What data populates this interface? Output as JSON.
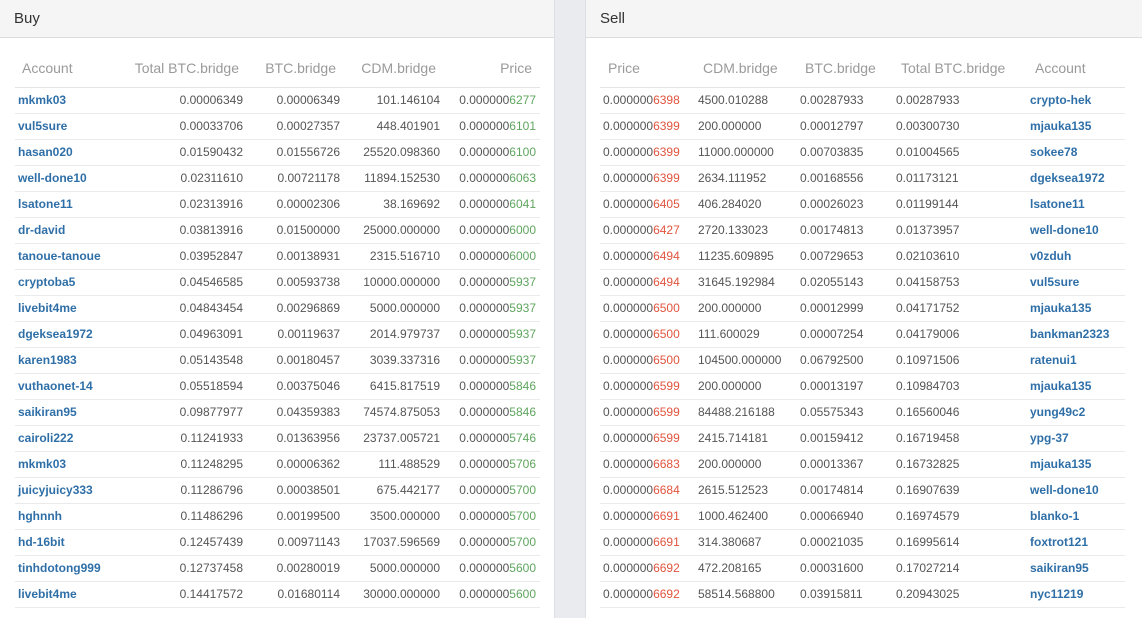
{
  "buy": {
    "title": "Buy",
    "columns": [
      "Account",
      "Total BTC.bridge",
      "BTC.bridge",
      "CDM.bridge",
      "Price"
    ],
    "rows": [
      {
        "account": "mkmk03",
        "total": "0.00006349",
        "btc": "0.00006349",
        "cdm": "101.146104",
        "price": "0.0000006277"
      },
      {
        "account": "vul5sure",
        "total": "0.00033706",
        "btc": "0.00027357",
        "cdm": "448.401901",
        "price": "0.0000006101"
      },
      {
        "account": "hasan020",
        "total": "0.01590432",
        "btc": "0.01556726",
        "cdm": "25520.098360",
        "price": "0.0000006100"
      },
      {
        "account": "well-done10",
        "total": "0.02311610",
        "btc": "0.00721178",
        "cdm": "11894.152530",
        "price": "0.0000006063"
      },
      {
        "account": "lsatone11",
        "total": "0.02313916",
        "btc": "0.00002306",
        "cdm": "38.169692",
        "price": "0.0000006041"
      },
      {
        "account": "dr-david",
        "total": "0.03813916",
        "btc": "0.01500000",
        "cdm": "25000.000000",
        "price": "0.0000006000"
      },
      {
        "account": "tanoue-tanoue",
        "total": "0.03952847",
        "btc": "0.00138931",
        "cdm": "2315.516710",
        "price": "0.0000006000"
      },
      {
        "account": "cryptoba5",
        "total": "0.04546585",
        "btc": "0.00593738",
        "cdm": "10000.000000",
        "price": "0.0000005937"
      },
      {
        "account": "livebit4me",
        "total": "0.04843454",
        "btc": "0.00296869",
        "cdm": "5000.000000",
        "price": "0.0000005937"
      },
      {
        "account": "dgeksea1972",
        "total": "0.04963091",
        "btc": "0.00119637",
        "cdm": "2014.979737",
        "price": "0.0000005937"
      },
      {
        "account": "karen1983",
        "total": "0.05143548",
        "btc": "0.00180457",
        "cdm": "3039.337316",
        "price": "0.0000005937"
      },
      {
        "account": "vuthaonet-14",
        "total": "0.05518594",
        "btc": "0.00375046",
        "cdm": "6415.817519",
        "price": "0.0000005846"
      },
      {
        "account": "saikiran95",
        "total": "0.09877977",
        "btc": "0.04359383",
        "cdm": "74574.875053",
        "price": "0.0000005846"
      },
      {
        "account": "cairoli222",
        "total": "0.11241933",
        "btc": "0.01363956",
        "cdm": "23737.005721",
        "price": "0.0000005746"
      },
      {
        "account": "mkmk03",
        "total": "0.11248295",
        "btc": "0.00006362",
        "cdm": "111.488529",
        "price": "0.0000005706"
      },
      {
        "account": "juicyjuicy333",
        "total": "0.11286796",
        "btc": "0.00038501",
        "cdm": "675.442177",
        "price": "0.0000005700"
      },
      {
        "account": "hghnnh",
        "total": "0.11486296",
        "btc": "0.00199500",
        "cdm": "3500.000000",
        "price": "0.0000005700"
      },
      {
        "account": "hd-16bit",
        "total": "0.12457439",
        "btc": "0.00971143",
        "cdm": "17037.596569",
        "price": "0.0000005700"
      },
      {
        "account": "tinhdotong999",
        "total": "0.12737458",
        "btc": "0.00280019",
        "cdm": "5000.000000",
        "price": "0.0000005600"
      },
      {
        "account": "livebit4me",
        "total": "0.14417572",
        "btc": "0.01680114",
        "cdm": "30000.000000",
        "price": "0.0000005600"
      }
    ]
  },
  "sell": {
    "title": "Sell",
    "columns": [
      "Price",
      "CDM.bridge",
      "BTC.bridge",
      "Total BTC.bridge",
      "Account"
    ],
    "rows": [
      {
        "price": "0.0000006398",
        "cdm": "4500.010288",
        "btc": "0.00287933",
        "total": "0.00287933",
        "account": "crypto-hek"
      },
      {
        "price": "0.0000006399",
        "cdm": "200.000000",
        "btc": "0.00012797",
        "total": "0.00300730",
        "account": "mjauka135"
      },
      {
        "price": "0.0000006399",
        "cdm": "11000.000000",
        "btc": "0.00703835",
        "total": "0.01004565",
        "account": "sokee78"
      },
      {
        "price": "0.0000006399",
        "cdm": "2634.111952",
        "btc": "0.00168556",
        "total": "0.01173121",
        "account": "dgeksea1972"
      },
      {
        "price": "0.0000006405",
        "cdm": "406.284020",
        "btc": "0.00026023",
        "total": "0.01199144",
        "account": "lsatone11"
      },
      {
        "price": "0.0000006427",
        "cdm": "2720.133023",
        "btc": "0.00174813",
        "total": "0.01373957",
        "account": "well-done10"
      },
      {
        "price": "0.0000006494",
        "cdm": "11235.609895",
        "btc": "0.00729653",
        "total": "0.02103610",
        "account": "v0zduh"
      },
      {
        "price": "0.0000006494",
        "cdm": "31645.192984",
        "btc": "0.02055143",
        "total": "0.04158753",
        "account": "vul5sure"
      },
      {
        "price": "0.0000006500",
        "cdm": "200.000000",
        "btc": "0.00012999",
        "total": "0.04171752",
        "account": "mjauka135"
      },
      {
        "price": "0.0000006500",
        "cdm": "111.600029",
        "btc": "0.00007254",
        "total": "0.04179006",
        "account": "bankman2323"
      },
      {
        "price": "0.0000006500",
        "cdm": "104500.000000",
        "btc": "0.06792500",
        "total": "0.10971506",
        "account": "ratenui1"
      },
      {
        "price": "0.0000006599",
        "cdm": "200.000000",
        "btc": "0.00013197",
        "total": "0.10984703",
        "account": "mjauka135"
      },
      {
        "price": "0.0000006599",
        "cdm": "84488.216188",
        "btc": "0.05575343",
        "total": "0.16560046",
        "account": "yung49c2"
      },
      {
        "price": "0.0000006599",
        "cdm": "2415.714181",
        "btc": "0.00159412",
        "total": "0.16719458",
        "account": "ypg-37"
      },
      {
        "price": "0.0000006683",
        "cdm": "200.000000",
        "btc": "0.00013367",
        "total": "0.16732825",
        "account": "mjauka135"
      },
      {
        "price": "0.0000006684",
        "cdm": "2615.512523",
        "btc": "0.00174814",
        "total": "0.16907639",
        "account": "well-done10"
      },
      {
        "price": "0.0000006691",
        "cdm": "1000.462400",
        "btc": "0.00066940",
        "total": "0.16974579",
        "account": "blanko-1"
      },
      {
        "price": "0.0000006691",
        "cdm": "314.380687",
        "btc": "0.00021035",
        "total": "0.16995614",
        "account": "foxtrot121"
      },
      {
        "price": "0.0000006692",
        "cdm": "472.208165",
        "btc": "0.00031600",
        "total": "0.17027214",
        "account": "saikiran95"
      },
      {
        "price": "0.0000006692",
        "cdm": "58514.568800",
        "btc": "0.03915811",
        "total": "0.20943025",
        "account": "nyc11219"
      }
    ]
  },
  "colors": {
    "link": "#2f6fa7",
    "buy_price_highlight": "#5fa55f",
    "sell_price_highlight": "#e0543e"
  }
}
